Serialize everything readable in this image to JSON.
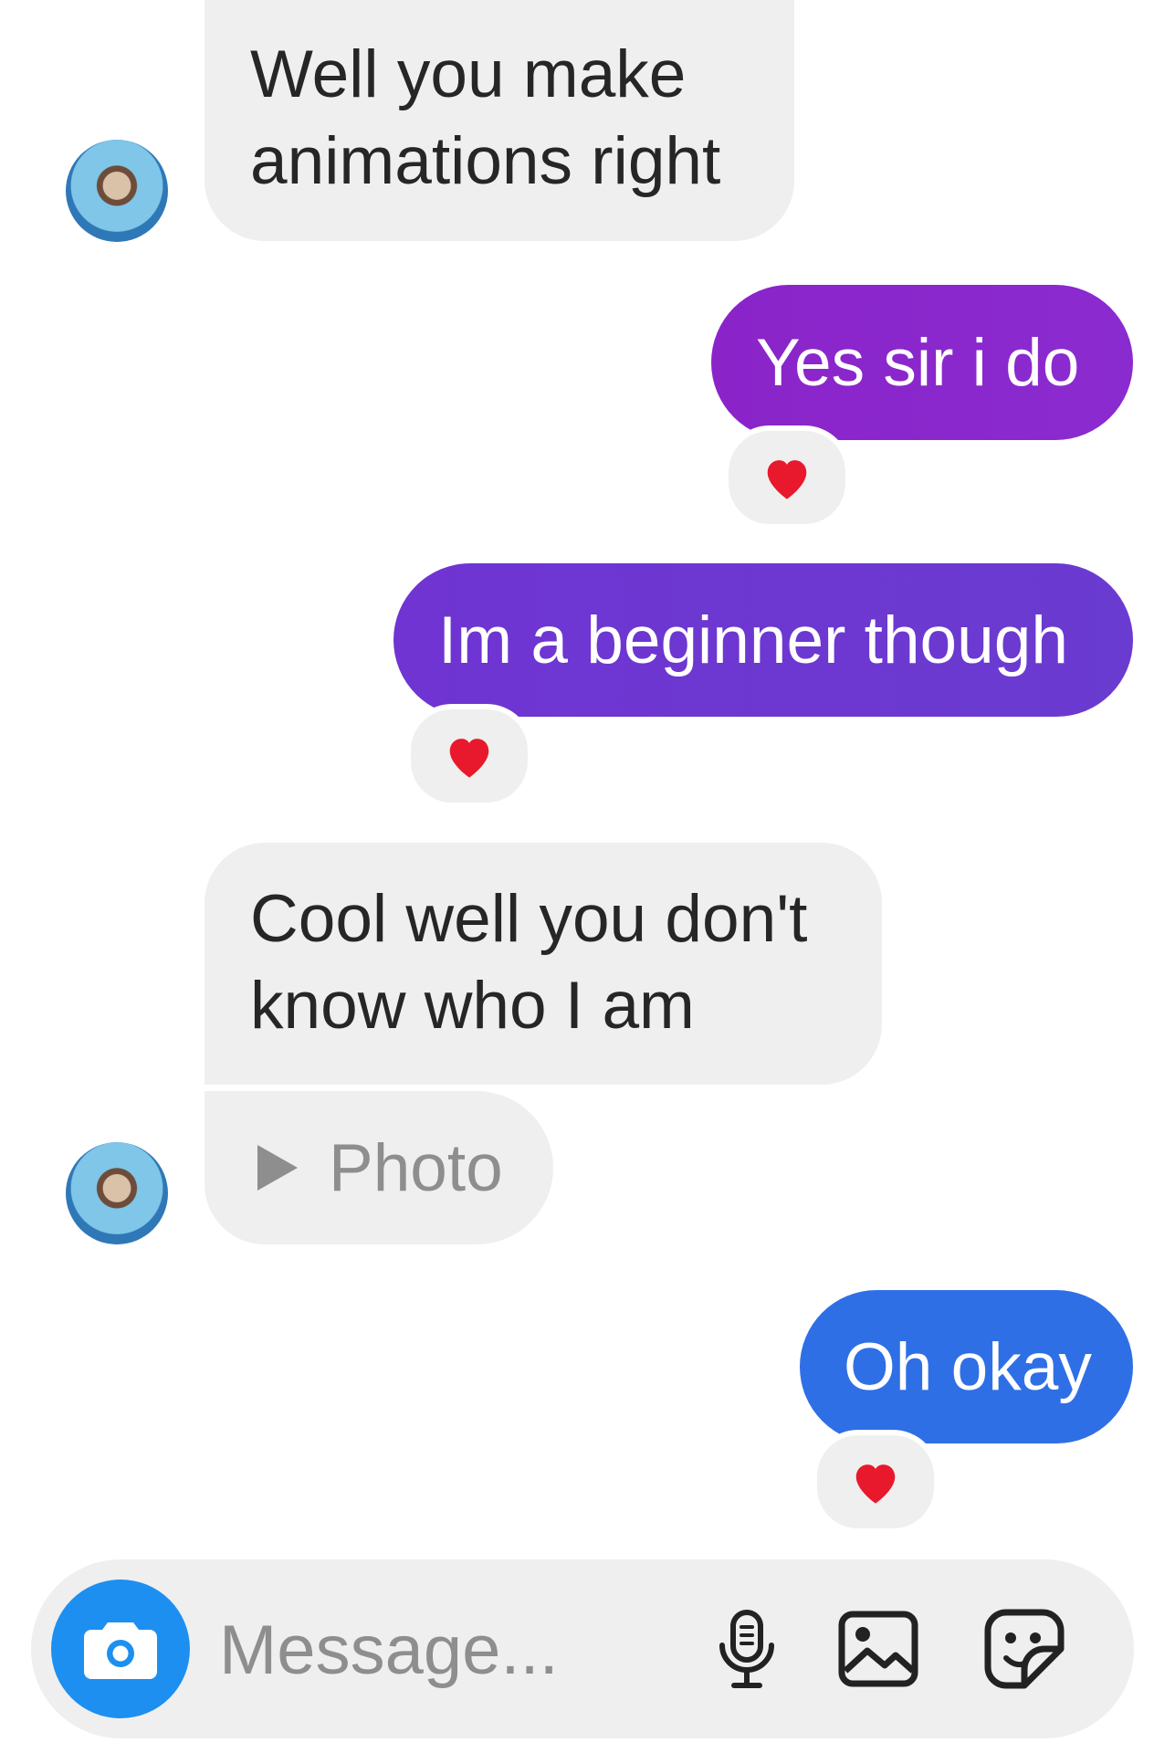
{
  "messages": [
    {
      "direction": "incoming",
      "text": "Well you make animations right"
    },
    {
      "direction": "outgoing",
      "text": "Yes sir i do",
      "reaction": "heart"
    },
    {
      "direction": "outgoing",
      "text": "Im a beginner though",
      "reaction": "heart"
    },
    {
      "direction": "incoming",
      "text": "Cool well you don't know who I am"
    },
    {
      "direction": "incoming",
      "type": "attachment",
      "text": "Photo"
    },
    {
      "direction": "outgoing",
      "text": "Oh okay",
      "reaction": "heart"
    }
  ],
  "composer": {
    "placeholder": "Message...",
    "icons": [
      "camera-icon",
      "microphone-icon",
      "gallery-icon",
      "sticker-icon"
    ]
  },
  "colors": {
    "incoming_bubble": "#efefef",
    "outgoing_top": "#8a24c9",
    "outgoing_middle": "#6c39d0",
    "outgoing_bottom": "#2f6fe6",
    "camera_button": "#1d8ff0",
    "heart": "#e8192c"
  }
}
